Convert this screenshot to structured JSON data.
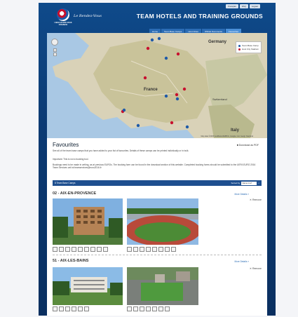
{
  "header": {
    "top_links": [
      "Français",
      "FAQ",
      "Logout"
    ],
    "logo_text": "UEFA EURO 2016 FRANCE",
    "tagline": "Le Rendez-Vous",
    "title": "TEAM HOTELS AND TRAINING GROUNDS",
    "nav": [
      "Home",
      "Team Base Camps",
      "Host Cities",
      "Official Documents",
      "Favourites"
    ],
    "active_nav": "Favourites"
  },
  "map": {
    "legend": [
      "Team Base Camp",
      "Host City Stadium"
    ],
    "labels": [
      "Germany",
      "France",
      "Italy",
      "Switzerland"
    ],
    "attribution": "Map data ©2015 GeoBasis-DE/BKG, Google, Inst. Geogr. Nacional",
    "zoom_in": "+",
    "zoom_out": "−"
  },
  "favourites": {
    "heading": "Favourites",
    "download": "Download as PDF",
    "intro": "See all of the team base camps that you have added to your list of favourites. Details of these camps can be printed individually or in bulk.",
    "important": "Important: This is not a booking tool.",
    "bookings": "Bookings need to be made in writing, as at previous EUROs. The booking form can be found in the download section of this website. Completed booking forms should be submitted to the UEFA EURO 2016 Team Services unit at teamservices@euro2016.fr",
    "filter_label": "8 Team Base Camps",
    "sort_label": "Sorted by",
    "sort_value": "Name A-Z"
  },
  "hotels": [
    {
      "name": "02 - AIX-EN-PROVENCE",
      "more": "More Details »",
      "remove": "Remove"
    },
    {
      "name": "51 - AIX-LES-BAINS",
      "more": "More Details »",
      "remove": "Remove"
    }
  ],
  "colors": {
    "brand_blue": "#0f4a8a",
    "nav_blue": "#2b6cb5",
    "camp_marker": "#1e5aa8",
    "stadium_marker": "#c8102e"
  }
}
